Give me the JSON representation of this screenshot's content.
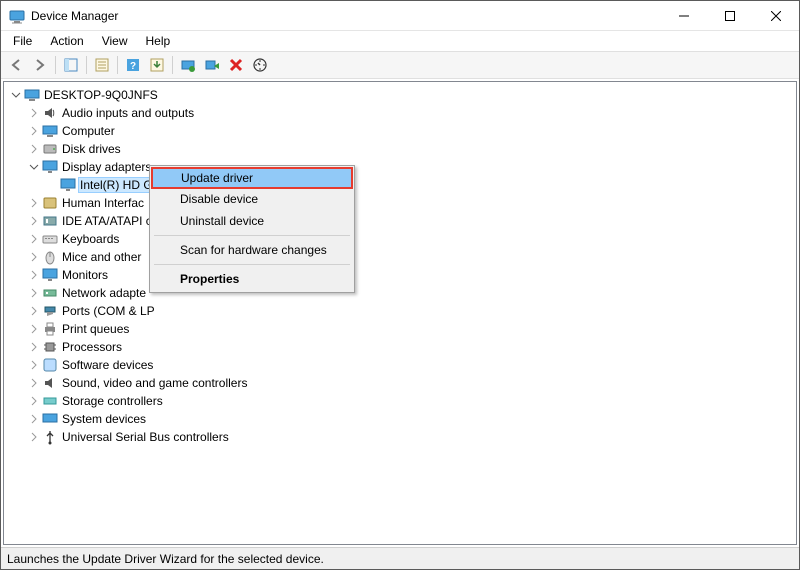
{
  "window": {
    "title": "Device Manager"
  },
  "menubar": [
    "File",
    "Action",
    "View",
    "Help"
  ],
  "tree": {
    "root": "DESKTOP-9Q0JNFS",
    "items": [
      "Audio inputs and outputs",
      "Computer",
      "Disk drives",
      "Display adapters",
      "Human Interface Devices",
      "IDE ATA/ATAPI controllers",
      "Keyboards",
      "Mice and other pointing devices",
      "Monitors",
      "Network adapters",
      "Ports (COM & LPT)",
      "Print queues",
      "Processors",
      "Software devices",
      "Sound, video and game controllers",
      "Storage controllers",
      "System devices",
      "Universal Serial Bus controllers"
    ],
    "display_child": "Intel(R) HD Graphics"
  },
  "context_menu": {
    "items": [
      "Update driver",
      "Disable device",
      "Uninstall device",
      "Scan for hardware changes",
      "Properties"
    ],
    "highlighted": 0,
    "bold": 4
  },
  "statusbar": "Launches the Update Driver Wizard for the selected device.",
  "truncated": {
    "human_interface": "Human Interfac",
    "ide": "IDE ATA/ATAPI c",
    "mice": "Mice and other",
    "network": "Network adapte",
    "ports": "Ports (COM & LP"
  }
}
